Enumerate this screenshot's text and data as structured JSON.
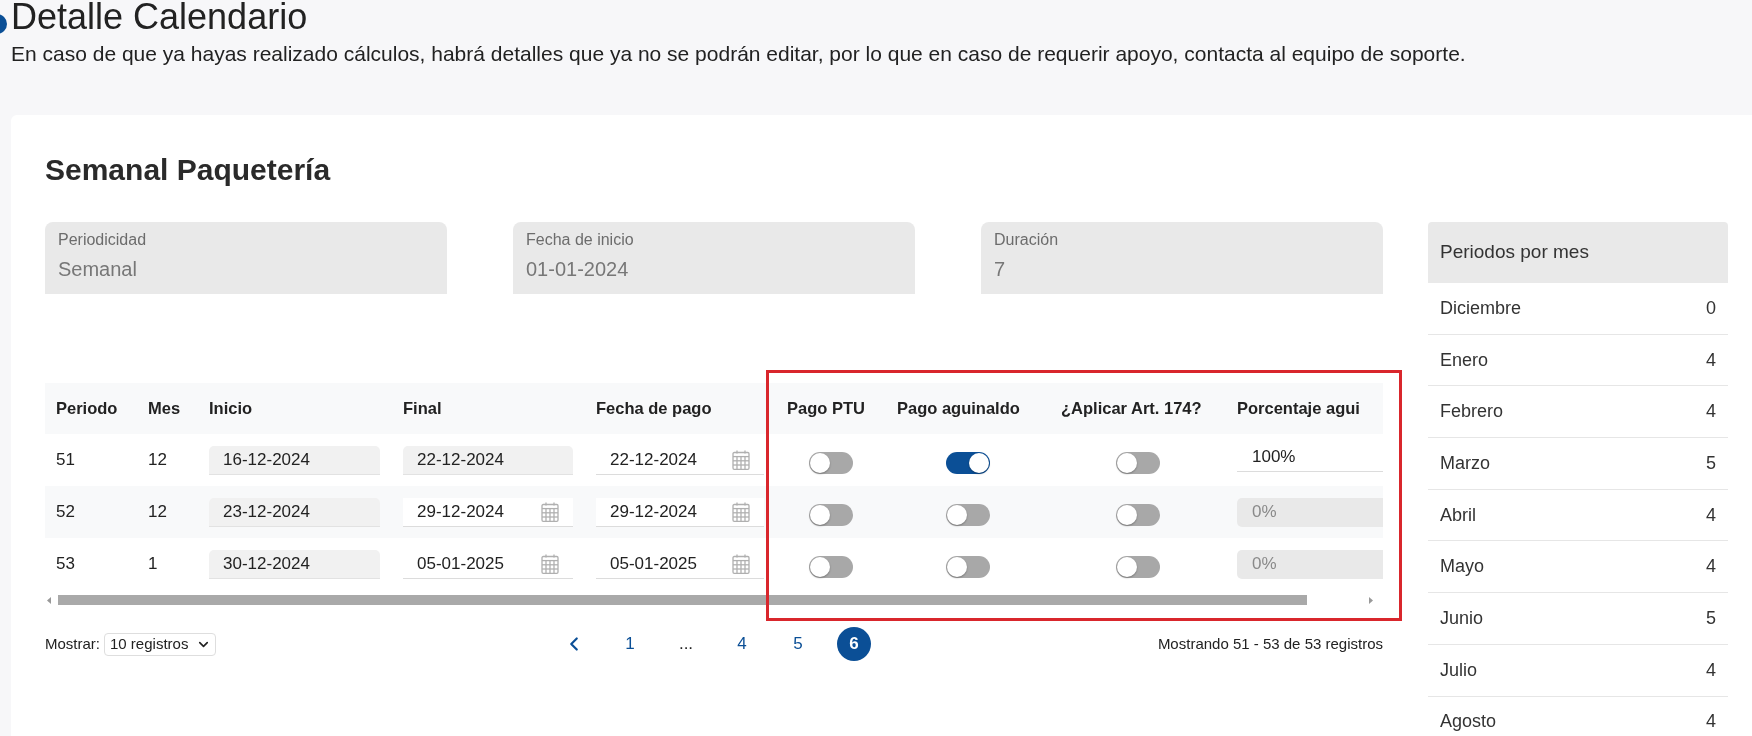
{
  "page": {
    "title": "Detalle Calendario",
    "description": "En caso de que ya hayas realizado cálculos, habrá detalles que ya no se podrán editar, por lo que en caso de requerir apoyo, contacta al equipo de soporte."
  },
  "calendar": {
    "title": "Semanal Paquetería",
    "fields": [
      {
        "label": "Periodicidad",
        "value": "Semanal",
        "disabled": true
      },
      {
        "label": "Fecha de inicio",
        "value": "01-01-2024",
        "disabled": true
      },
      {
        "label": "Duración",
        "value": "7",
        "disabled": true
      }
    ]
  },
  "table": {
    "columns": [
      "Periodo",
      "Mes",
      "Inicio",
      "Final",
      "Fecha de pago",
      "Pago PTU",
      "Pago aguinaldo",
      "¿Aplicar Art. 174?",
      "Porcentaje agui"
    ],
    "rows": [
      {
        "cells": [
          {
            "kind": "text",
            "value": "51"
          },
          {
            "kind": "text",
            "value": "12"
          },
          {
            "kind": "date",
            "value": "16-12-2024",
            "disabled": true
          },
          {
            "kind": "date",
            "value": "22-12-2024",
            "disabled": true
          },
          {
            "kind": "date",
            "value": "22-12-2024",
            "disabled": false
          },
          {
            "kind": "toggle",
            "on": false
          },
          {
            "kind": "toggle",
            "on": true
          },
          {
            "kind": "toggle",
            "on": false
          },
          {
            "kind": "input",
            "value": "100%",
            "disabled": false
          }
        ]
      },
      {
        "cells": [
          {
            "kind": "text",
            "value": "52"
          },
          {
            "kind": "text",
            "value": "12"
          },
          {
            "kind": "date",
            "value": "23-12-2024",
            "disabled": true
          },
          {
            "kind": "date",
            "value": "29-12-2024",
            "disabled": false
          },
          {
            "kind": "date",
            "value": "29-12-2024",
            "disabled": false
          },
          {
            "kind": "toggle",
            "on": false
          },
          {
            "kind": "toggle",
            "on": false
          },
          {
            "kind": "toggle",
            "on": false
          },
          {
            "kind": "input",
            "value": "0%",
            "disabled": true
          }
        ]
      },
      {
        "cells": [
          {
            "kind": "text",
            "value": "53"
          },
          {
            "kind": "text",
            "value": "1"
          },
          {
            "kind": "date",
            "value": "30-12-2024",
            "disabled": true
          },
          {
            "kind": "date",
            "value": "05-01-2025",
            "disabled": false
          },
          {
            "kind": "date",
            "value": "05-01-2025",
            "disabled": false
          },
          {
            "kind": "toggle",
            "on": false
          },
          {
            "kind": "toggle",
            "on": false
          },
          {
            "kind": "toggle",
            "on": false
          },
          {
            "kind": "input",
            "value": "0%",
            "disabled": true
          }
        ]
      }
    ]
  },
  "page_size": {
    "label": "Mostrar:",
    "value": "10 registros"
  },
  "pagination": {
    "pages": [
      {
        "kind": "page",
        "label": "1",
        "selected": false
      },
      {
        "kind": "ellipsis",
        "label": "...",
        "selected": false
      },
      {
        "kind": "page",
        "label": "4",
        "selected": false
      },
      {
        "kind": "page",
        "label": "5",
        "selected": false
      },
      {
        "kind": "page",
        "label": "6",
        "selected": true
      }
    ],
    "summary": "Mostrando 51 - 53 de 53 registros"
  },
  "periods_panel": {
    "title": "Periodos por mes",
    "rows": [
      {
        "month": "Diciembre",
        "count": "0"
      },
      {
        "month": "Enero",
        "count": "4"
      },
      {
        "month": "Febrero",
        "count": "4"
      },
      {
        "month": "Marzo",
        "count": "5"
      },
      {
        "month": "Abril",
        "count": "4"
      },
      {
        "month": "Mayo",
        "count": "4"
      },
      {
        "month": "Junio",
        "count": "5"
      },
      {
        "month": "Julio",
        "count": "4"
      },
      {
        "month": "Agosto",
        "count": "4"
      }
    ]
  },
  "annotation": {
    "kind": "frame"
  }
}
